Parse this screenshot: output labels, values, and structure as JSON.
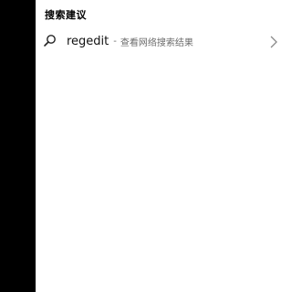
{
  "section_title": "搜索建议",
  "suggestion": {
    "query": "regedit",
    "separator": "-",
    "description": "查看网络搜索结果",
    "icon": "search-icon",
    "chevron_icon": "chevron-right-icon"
  },
  "colors": {
    "left_strip": "#000000",
    "panel_background": "#ffffff",
    "secondary_text": "#6b6b6b"
  }
}
